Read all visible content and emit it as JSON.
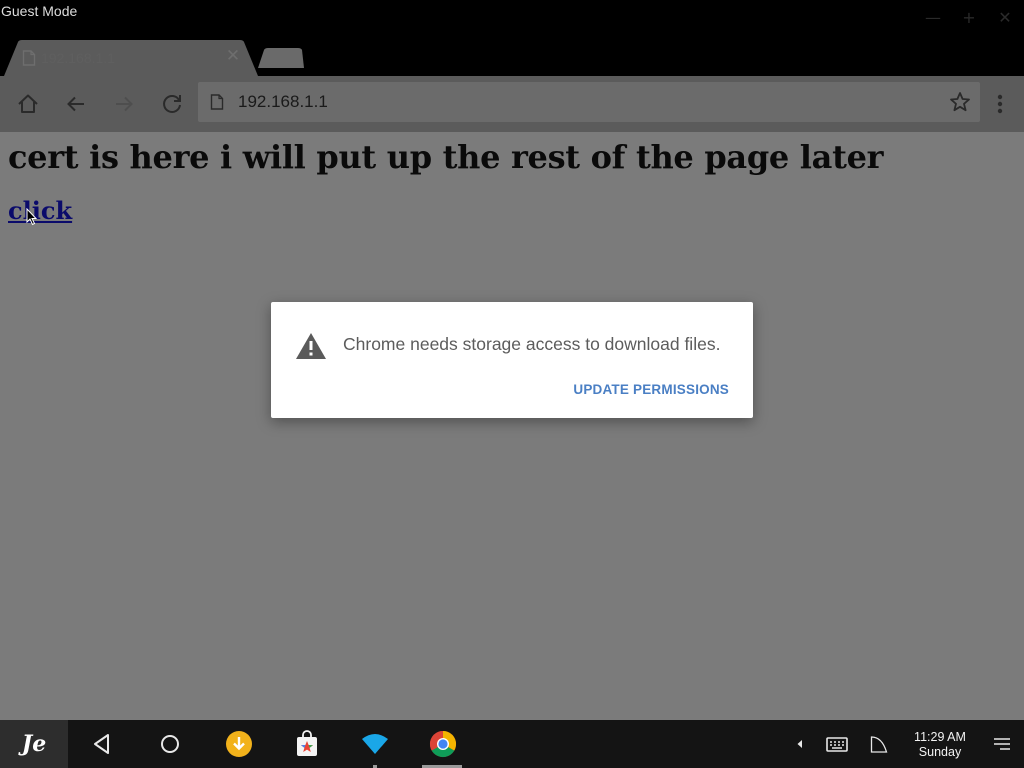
{
  "window": {
    "mode_label": "Guest Mode",
    "controls": [
      "minimize-icon",
      "maximize-icon",
      "close-icon"
    ]
  },
  "tab": {
    "title": "192.168.1.1",
    "close_glyph": "✕"
  },
  "toolbar": {
    "url": "192.168.1.1",
    "icons": [
      "home-icon",
      "back-icon",
      "forward-icon",
      "reload-icon",
      "page-icon",
      "star-icon",
      "menu-icon"
    ]
  },
  "page": {
    "heading": "cert is here i will put up the rest of the page later",
    "link_text": "click"
  },
  "dialog": {
    "message": "Chrome needs storage access to download files.",
    "button_label": "UPDATE PERMISSIONS",
    "icon": "warning-icon",
    "accent_color": "#4a7fc4"
  },
  "taskbar": {
    "start_glyph": "Je",
    "apps": [
      "back-icon",
      "home-icon",
      "download-icon",
      "store-icon",
      "wifi-icon",
      "chrome-icon"
    ],
    "tray": [
      "expand-arrow-icon",
      "keyboard-icon",
      "signal-icon",
      "notifications-icon"
    ],
    "clock_time": "11:29 AM",
    "clock_day": "Sunday"
  }
}
